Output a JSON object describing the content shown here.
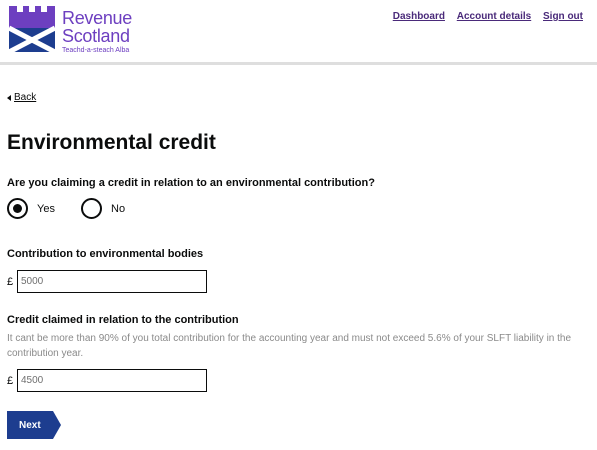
{
  "brand": {
    "line1": "Revenue",
    "line2": "Scotland",
    "line3": "Teachd-a-steach Alba",
    "color": "#6d3fc0"
  },
  "topnav": {
    "dashboard": "Dashboard",
    "account_details": "Account details",
    "sign_out": "Sign out"
  },
  "back_label": "Back",
  "page_title": "Environmental credit",
  "question": {
    "label": "Are you claiming a credit in relation to an environmental contribution?",
    "options": [
      {
        "label": "Yes",
        "selected": true
      },
      {
        "label": "No",
        "selected": false
      }
    ]
  },
  "contribution": {
    "label": "Contribution to environmental bodies",
    "currency": "£",
    "value": "5000"
  },
  "credit": {
    "label": "Credit claimed in relation to the contribution",
    "hint": "It cant be more than 90% of you total contribution for the accounting year and must not exceed 5.6% of your SLFT liability in the contribution year.",
    "currency": "£",
    "value": "4500"
  },
  "next_label": "Next",
  "colors": {
    "button": "#1d3d8f",
    "link": "#4a2a7a"
  }
}
